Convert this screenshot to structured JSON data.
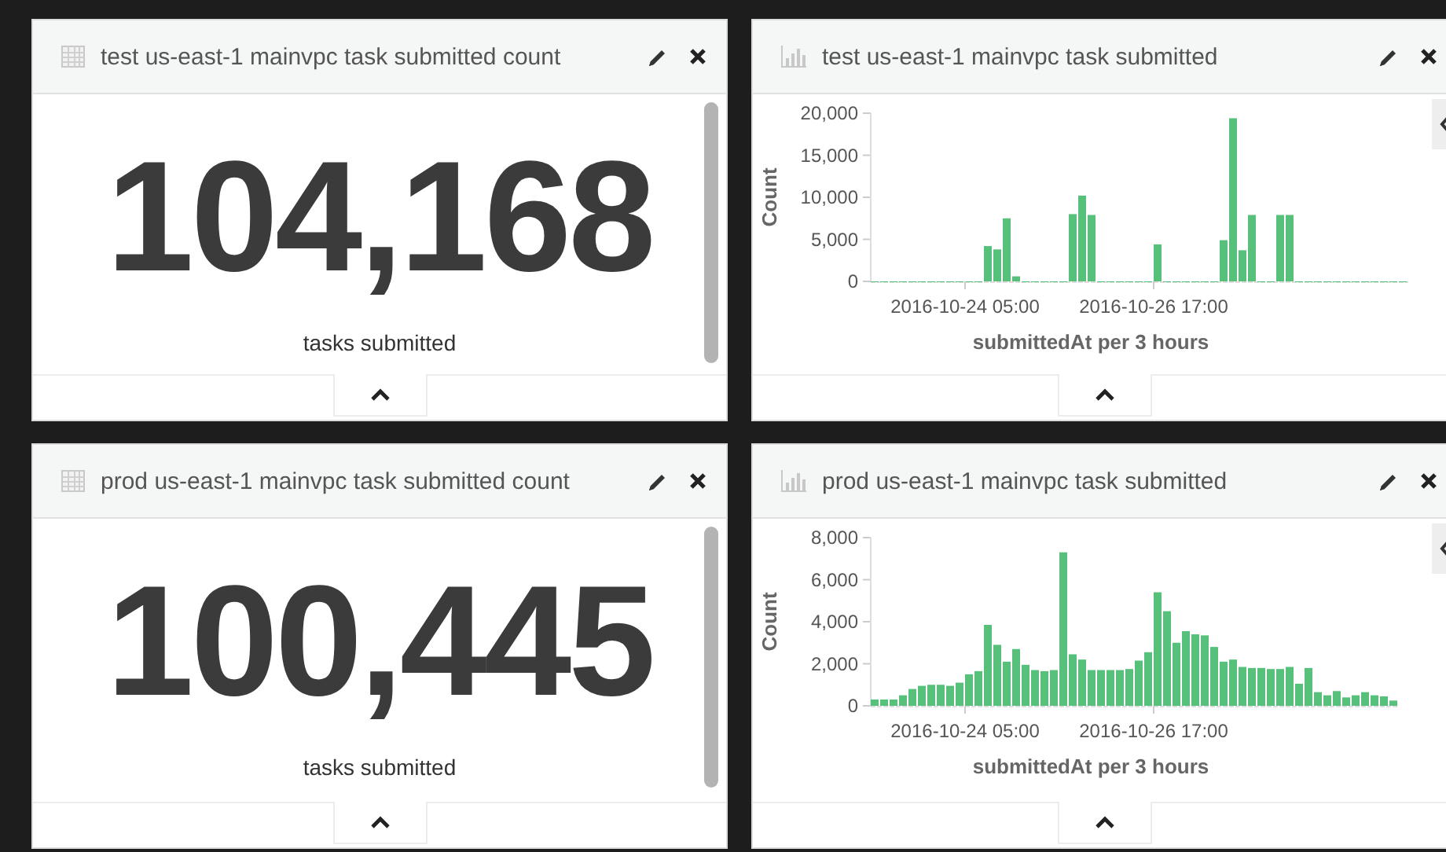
{
  "panels": [
    {
      "kind": "metric",
      "title": "test us-east-1 mainvpc task submitted count",
      "value": "104,168",
      "label": "tasks submitted"
    },
    {
      "kind": "chart",
      "title": "test us-east-1 mainvpc task submitted",
      "chart_data": {
        "type": "bar",
        "xlabel": "submittedAt per 3 hours",
        "ylabel": "Count",
        "categories": [
          null,
          null,
          null,
          null,
          null,
          null,
          null,
          null,
          null,
          null,
          "2016-10-24 05:00",
          null,
          null,
          null,
          null,
          null,
          null,
          null,
          null,
          null,
          null,
          null,
          null,
          null,
          null,
          null,
          null,
          null,
          null,
          null,
          "2016-10-26 17:00",
          null,
          null,
          null,
          null,
          null,
          null,
          null,
          null,
          null,
          null,
          null,
          null,
          null,
          null,
          null,
          null,
          null,
          null,
          null,
          null,
          null,
          null,
          null,
          null,
          null,
          null
        ],
        "series": [
          {
            "color": "#57c17b",
            "values": [
              0,
              0,
              0,
              0,
              0,
              0,
              0,
              0,
              0,
              0,
              0,
              0,
              4200,
              3800,
              7500,
              600,
              0,
              0,
              0,
              0,
              0,
              8000,
              10200,
              7900,
              0,
              0,
              0,
              0,
              0,
              0,
              4400,
              0,
              0,
              0,
              0,
              0,
              0,
              4900,
              19400,
              3700,
              7900,
              0,
              0,
              7900,
              7900,
              0,
              0,
              0,
              0,
              0,
              0,
              0,
              0,
              0,
              0,
              0,
              0
            ]
          }
        ],
        "ylim": [
          0,
          20000
        ],
        "yticks": [
          {
            "value": 0,
            "label": "0"
          },
          {
            "value": 5000,
            "label": "5,000"
          },
          {
            "value": 10000,
            "label": "10,000"
          },
          {
            "value": 15000,
            "label": "15,000"
          },
          {
            "value": 20000,
            "label": "20,000"
          }
        ]
      }
    },
    {
      "kind": "metric",
      "title": "prod us-east-1 mainvpc task submitted count",
      "value": "100,445",
      "label": "tasks submitted"
    },
    {
      "kind": "chart",
      "title": "prod us-east-1 mainvpc task submitted",
      "chart_data": {
        "type": "bar",
        "xlabel": "submittedAt per 3 hours",
        "ylabel": "Count",
        "categories": [
          null,
          null,
          null,
          null,
          null,
          null,
          null,
          null,
          null,
          null,
          "2016-10-24 05:00",
          null,
          null,
          null,
          null,
          null,
          null,
          null,
          null,
          null,
          null,
          null,
          null,
          null,
          null,
          null,
          null,
          null,
          null,
          null,
          "2016-10-26 17:00",
          null,
          null,
          null,
          null,
          null,
          null,
          null,
          null,
          null,
          null,
          null,
          null,
          null,
          null,
          null,
          null,
          null,
          null,
          null,
          null,
          null,
          null,
          null,
          null,
          null
        ],
        "series": [
          {
            "color": "#57c17b",
            "values": [
              300,
              300,
              300,
              500,
              800,
              950,
              1000,
              1000,
              950,
              1100,
              1500,
              1650,
              3850,
              2900,
              2100,
              2700,
              1950,
              1700,
              1650,
              1700,
              7300,
              2450,
              2200,
              1700,
              1700,
              1700,
              1700,
              1750,
              2150,
              2550,
              5400,
              4500,
              3000,
              3550,
              3400,
              3350,
              2800,
              2100,
              2200,
              1850,
              1800,
              1800,
              1750,
              1750,
              1850,
              1050,
              1800,
              650,
              500,
              700,
              400,
              500,
              650,
              500,
              450,
              250
            ]
          }
        ],
        "ylim": [
          0,
          8000
        ],
        "yticks": [
          {
            "value": 0,
            "label": "0"
          },
          {
            "value": 2000,
            "label": "2,000"
          },
          {
            "value": 4000,
            "label": "4,000"
          },
          {
            "value": 6000,
            "label": "6,000"
          },
          {
            "value": 8000,
            "label": "8,000"
          }
        ]
      }
    }
  ]
}
